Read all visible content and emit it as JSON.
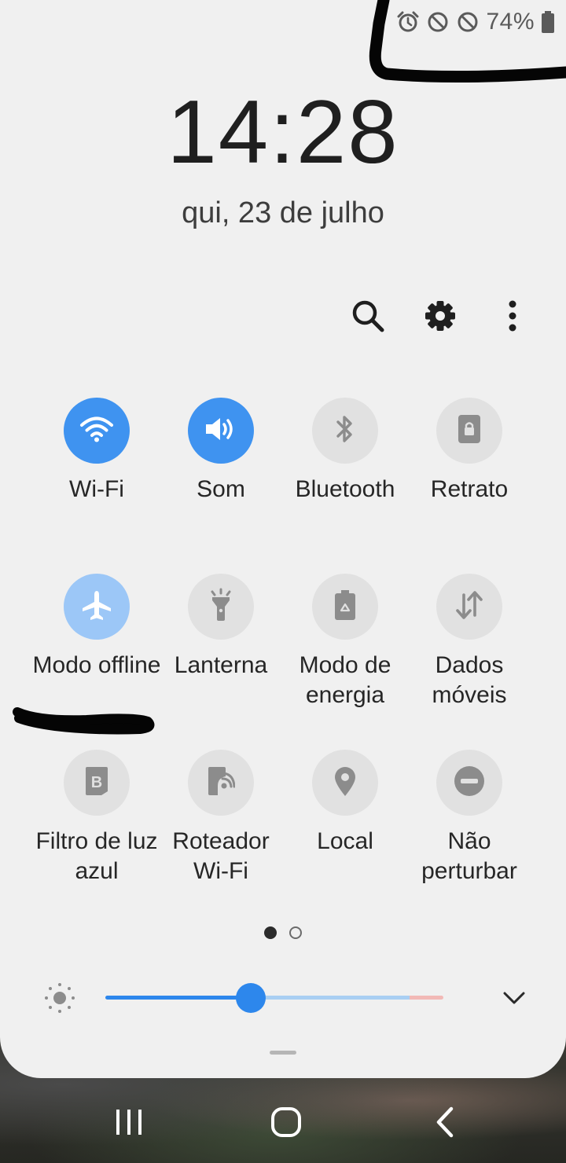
{
  "status_bar": {
    "icons": [
      "alarm-icon",
      "blocked-icon",
      "blocked-icon",
      "battery-icon"
    ],
    "battery_percent": "74%"
  },
  "clock": {
    "time": "14:28",
    "date": "qui, 23 de julho"
  },
  "toolbar": {
    "icons": [
      "search-icon",
      "settings-icon",
      "more-options-icon"
    ]
  },
  "tiles": [
    {
      "label": "Wi-Fi",
      "icon": "wifi-icon",
      "state": "on"
    },
    {
      "label": "Som",
      "icon": "sound-icon",
      "state": "on"
    },
    {
      "label": "Bluetooth",
      "icon": "bluetooth-icon",
      "state": "off"
    },
    {
      "label": "Retrato",
      "icon": "portrait-lock-icon",
      "state": "off"
    },
    {
      "label": "Modo offline",
      "icon": "airplane-icon",
      "state": "on-dim"
    },
    {
      "label": "Lanterna",
      "icon": "flashlight-icon",
      "state": "off"
    },
    {
      "label": "Modo de energia",
      "icon": "power-mode-icon",
      "state": "off"
    },
    {
      "label": "Dados móveis",
      "icon": "mobile-data-icon",
      "state": "off"
    },
    {
      "label": "Filtro de luz azul",
      "icon": "blue-light-filter-icon",
      "state": "off"
    },
    {
      "label": "Roteador Wi-Fi",
      "icon": "hotspot-icon",
      "state": "off"
    },
    {
      "label": "Local",
      "icon": "location-icon",
      "state": "off"
    },
    {
      "label": "Não perturbar",
      "icon": "do-not-disturb-icon",
      "state": "off"
    }
  ],
  "pager": {
    "current_page": 1,
    "total_pages": 2
  },
  "brightness": {
    "level": 0.43,
    "icon": "brightness-icon"
  },
  "colors": {
    "panel_bg": "#f0f0f0",
    "tile_on": "#3f93f0",
    "tile_dim": "#9cc7f7",
    "tile_off": "#e1e1e1",
    "slider": "#2d87ec"
  },
  "navbar": {
    "icons": [
      "recent-apps-icon",
      "home-icon",
      "back-icon"
    ]
  }
}
